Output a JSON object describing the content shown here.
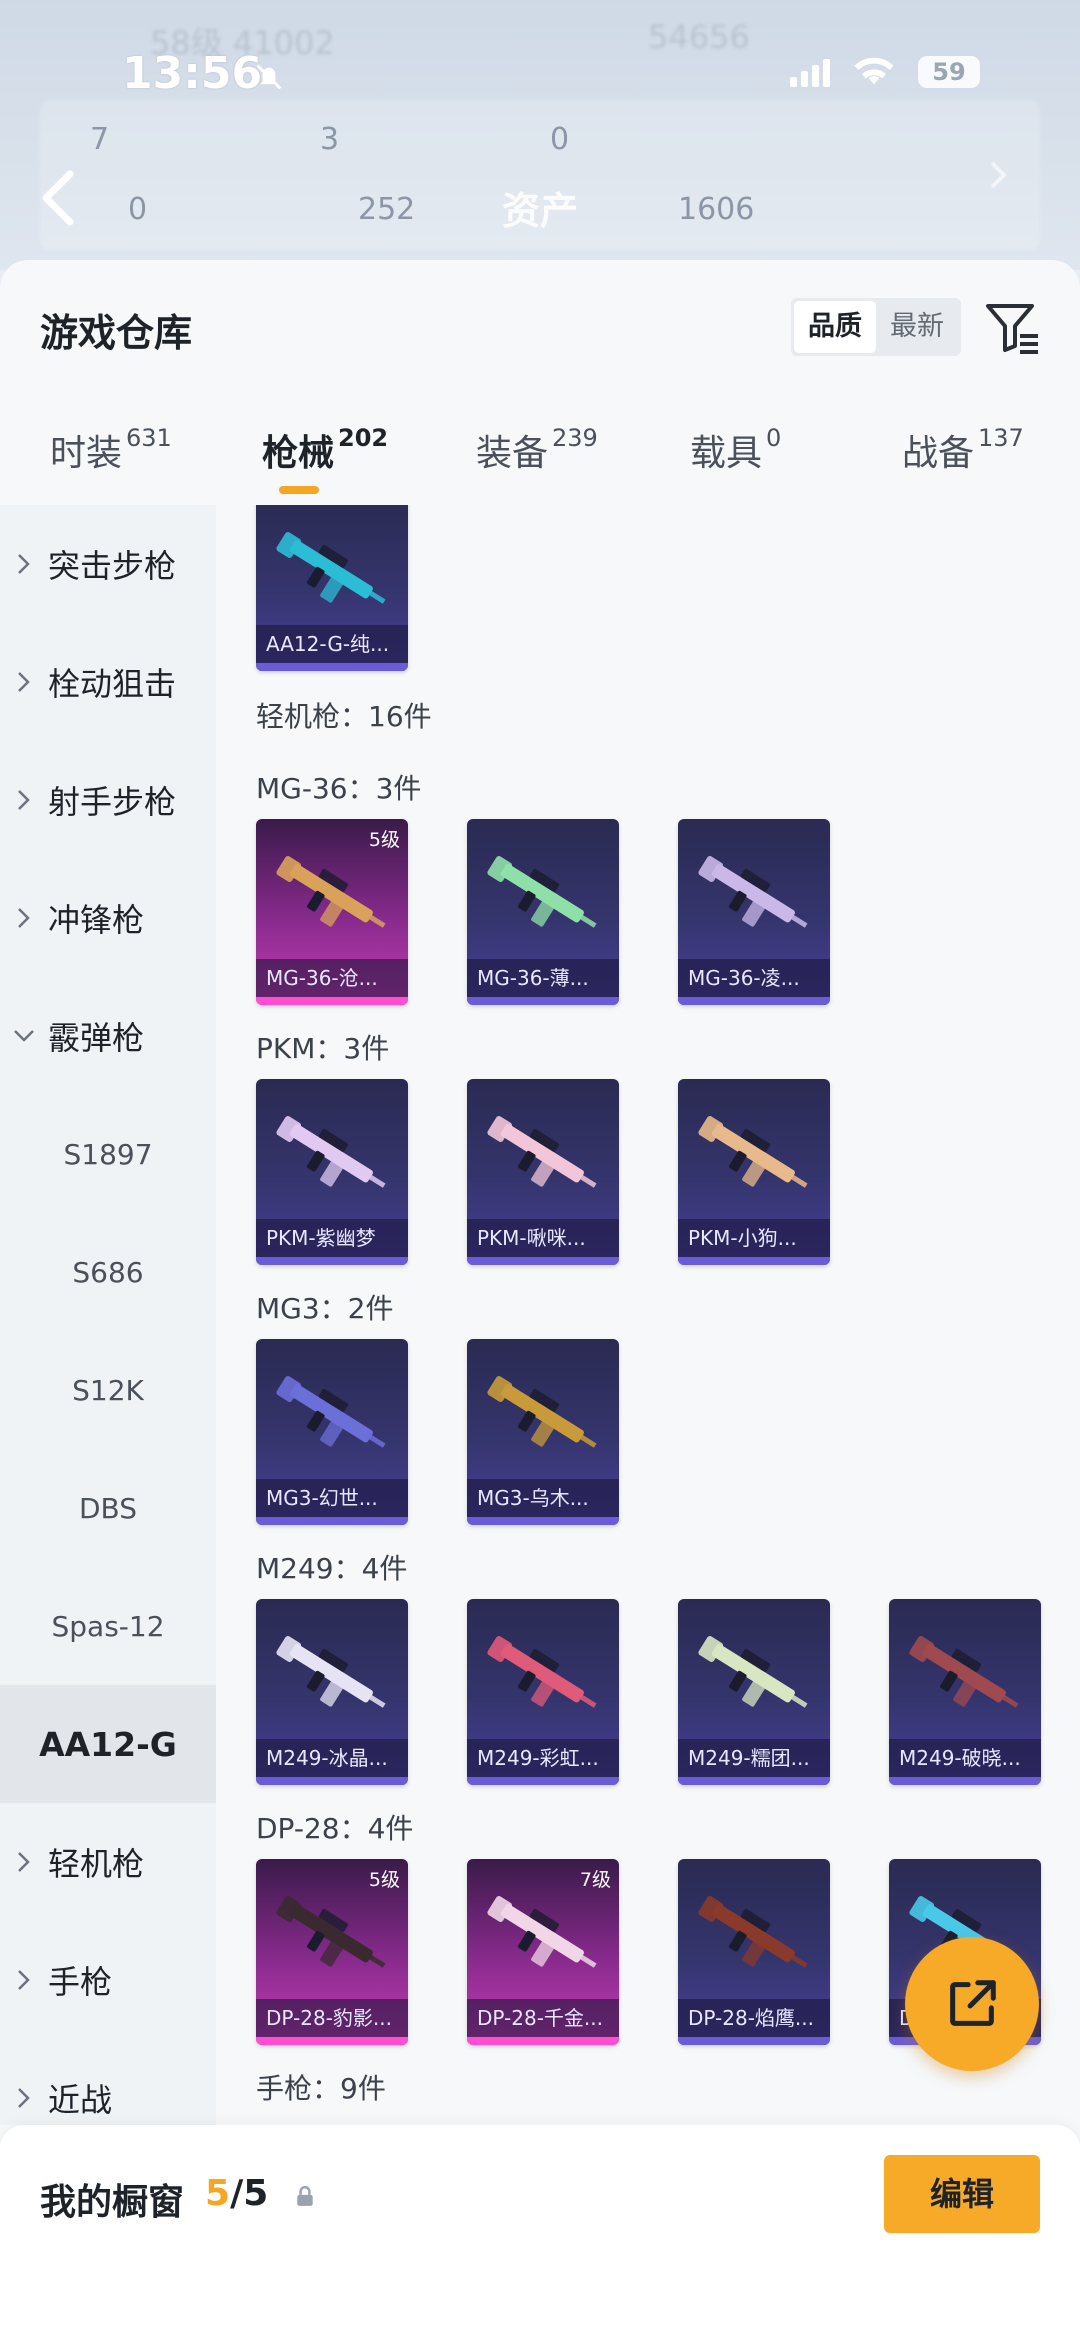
{
  "status_bar": {
    "time": "13:56",
    "battery": "59"
  },
  "backdrop": {
    "top_left": "58级   41002",
    "top_right": "54656",
    "row1": [
      "7",
      "3",
      "0"
    ],
    "row2": [
      "0",
      "252",
      "1606"
    ]
  },
  "header": {
    "title": "资产"
  },
  "sheet": {
    "title": "游戏仓库",
    "sort": {
      "quality": "品质",
      "newest": "最新"
    }
  },
  "tabs": [
    {
      "label": "时装",
      "count": "631"
    },
    {
      "label": "枪械",
      "count": "202"
    },
    {
      "label": "装备",
      "count": "239"
    },
    {
      "label": "载具",
      "count": "0"
    },
    {
      "label": "战备",
      "count": "137"
    }
  ],
  "sidenav": [
    {
      "label": "突击步枪",
      "type": "collapsed"
    },
    {
      "label": "栓动狙击",
      "type": "collapsed"
    },
    {
      "label": "射手步枪",
      "type": "collapsed"
    },
    {
      "label": "冲锋枪",
      "type": "collapsed"
    },
    {
      "label": "霰弹枪",
      "type": "expanded"
    },
    {
      "label": "S1897",
      "type": "sub"
    },
    {
      "label": "S686",
      "type": "sub"
    },
    {
      "label": "S12K",
      "type": "sub"
    },
    {
      "label": "DBS",
      "type": "sub"
    },
    {
      "label": "Spas-12",
      "type": "sub"
    },
    {
      "label": "AA12-G",
      "type": "selected"
    },
    {
      "label": "轻机枪",
      "type": "collapsed"
    },
    {
      "label": "手枪",
      "type": "collapsed"
    },
    {
      "label": "近战",
      "type": "collapsed"
    }
  ],
  "content": {
    "top_card": {
      "name": "AA12-G-纯...",
      "color": "#2bbcd6"
    },
    "category_total": "轻机枪：16件",
    "groups": [
      {
        "label": "MG-36：3件",
        "items": [
          {
            "name": "MG-36-沧...",
            "level": "5级",
            "pink": true,
            "color": "#d9a15a"
          },
          {
            "name": "MG-36-薄...",
            "level": "",
            "pink": false,
            "color": "#8fe0a8"
          },
          {
            "name": "MG-36-凌...",
            "level": "",
            "pink": false,
            "color": "#c9b8e8"
          }
        ]
      },
      {
        "label": "PKM：3件",
        "items": [
          {
            "name": "PKM-紫幽梦",
            "level": "",
            "pink": false,
            "color": "#e2c9f2"
          },
          {
            "name": "PKM-啾咪...",
            "level": "",
            "pink": false,
            "color": "#f2c6d8"
          },
          {
            "name": "PKM-小狗...",
            "level": "",
            "pink": false,
            "color": "#e8b98a"
          }
        ]
      },
      {
        "label": "MG3：2件",
        "items": [
          {
            "name": "MG3-幻世...",
            "level": "",
            "pink": false,
            "color": "#6b6fd8"
          },
          {
            "name": "MG3-乌木...",
            "level": "",
            "pink": false,
            "color": "#c89a3a"
          }
        ]
      },
      {
        "label": "M249：4件",
        "items": [
          {
            "name": "M249-冰晶...",
            "level": "",
            "pink": false,
            "color": "#e6e4f4"
          },
          {
            "name": "M249-彩虹...",
            "level": "",
            "pink": false,
            "color": "#e05a7a"
          },
          {
            "name": "M249-糯团...",
            "level": "",
            "pink": false,
            "color": "#d8e6c2"
          },
          {
            "name": "M249-破晓...",
            "level": "",
            "pink": false,
            "color": "#a04a50"
          }
        ]
      },
      {
        "label": "DP-28：4件",
        "items": [
          {
            "name": "DP-28-豹影...",
            "level": "5级",
            "pink": true,
            "color": "#3a2a30"
          },
          {
            "name": "DP-28-千金...",
            "level": "7级",
            "pink": true,
            "color": "#f0d6e6"
          },
          {
            "name": "DP-28-焰鹰...",
            "level": "",
            "pink": false,
            "color": "#8a3a2a"
          },
          {
            "name": "DP-28-...",
            "level": "",
            "pink": false,
            "color": "#4ac8e8"
          }
        ]
      }
    ],
    "next_label": "手枪：9件"
  },
  "showcase": {
    "title": "我的橱窗",
    "current": "5",
    "total": "5",
    "edit": "编辑"
  }
}
